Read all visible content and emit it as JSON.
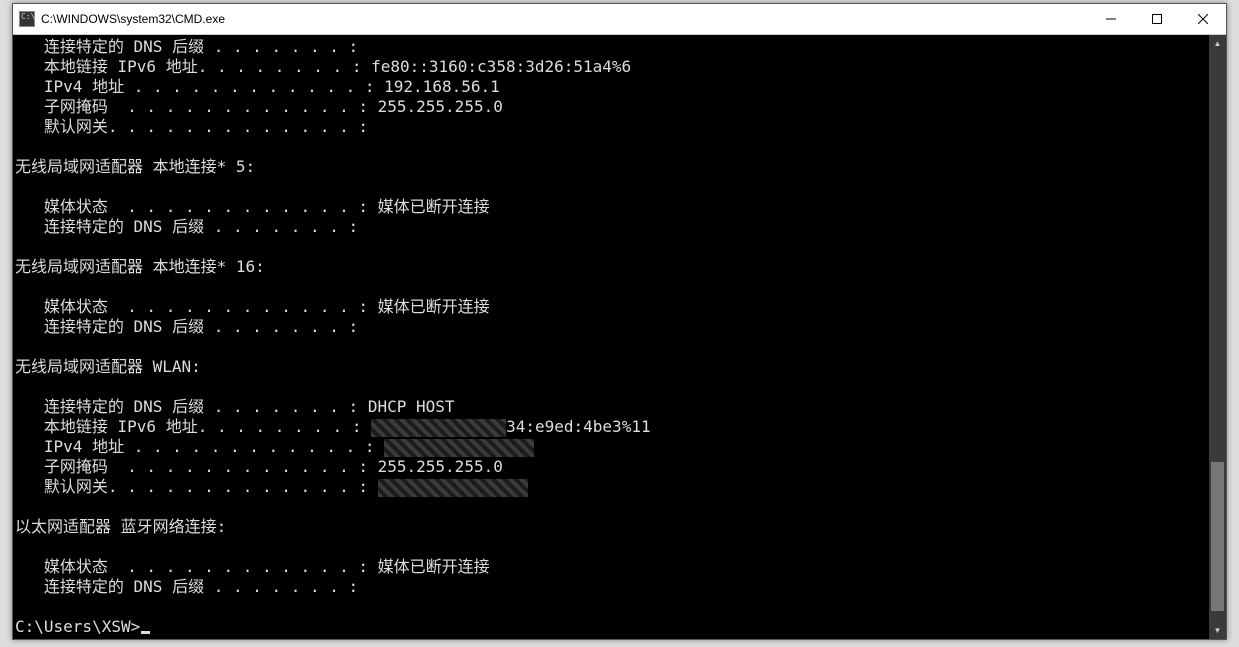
{
  "window": {
    "title": "C:\\WINDOWS\\system32\\CMD.exe"
  },
  "term": {
    "l1": "   连接特定的 DNS 后缀 . . . . . . . :",
    "l2": "   本地链接 IPv6 地址. . . . . . . . : fe80::3160:c358:3d26:51a4%6",
    "l3": "   IPv4 地址 . . . . . . . . . . . . : 192.168.56.1",
    "l4": "   子网掩码  . . . . . . . . . . . . : 255.255.255.0",
    "l5": "   默认网关. . . . . . . . . . . . . :",
    "blank": "",
    "l6": "无线局域网适配器 本地连接* 5:",
    "l7": "   媒体状态  . . . . . . . . . . . . : 媒体已断开连接",
    "l8": "   连接特定的 DNS 后缀 . . . . . . . :",
    "l9": "无线局域网适配器 本地连接* 16:",
    "l10": "   媒体状态  . . . . . . . . . . . . : 媒体已断开连接",
    "l11": "   连接特定的 DNS 后缀 . . . . . . . :",
    "l12": "无线局域网适配器 WLAN:",
    "l13": "   连接特定的 DNS 后缀 . . . . . . . : DHCP HOST",
    "l14a": "   本地链接 IPv6 地址. . . . . . . . : ",
    "l14b": "34:e9ed:4be3%11",
    "l15": "   IPv4 地址 . . . . . . . . . . . . : ",
    "l16": "   子网掩码  . . . . . . . . . . . . : 255.255.255.0",
    "l17": "   默认网关. . . . . . . . . . . . . : ",
    "l18": "以太网适配器 蓝牙网络连接:",
    "l19": "   媒体状态  . . . . . . . . . . . . : 媒体已断开连接",
    "l20": "   连接特定的 DNS 后缀 . . . . . . . :",
    "prompt": "C:\\Users\\XSW>"
  }
}
